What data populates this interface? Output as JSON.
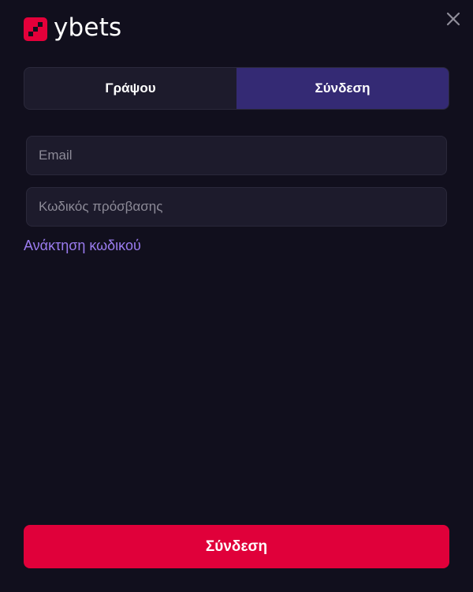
{
  "brand": {
    "name": "ybets",
    "logo_icon": "ybets-logo-icon",
    "accent_color": "#e4003a"
  },
  "close_icon": "close-icon",
  "tabs": [
    {
      "label": "Γράψου",
      "active": false
    },
    {
      "label": "Σύνδεση",
      "active": true
    }
  ],
  "form": {
    "email": {
      "placeholder": "Email",
      "value": ""
    },
    "password": {
      "placeholder": "Κωδικός πρόσβασης",
      "value": ""
    },
    "forgot_label": "Ανάκτηση κωδικού",
    "submit_label": "Σύνδεση"
  },
  "colors": {
    "background": "#110f1d",
    "field_bg": "#1d1b2c",
    "active_tab": "#342a74",
    "link": "#9b7cf0",
    "submit": "#e0003a"
  }
}
